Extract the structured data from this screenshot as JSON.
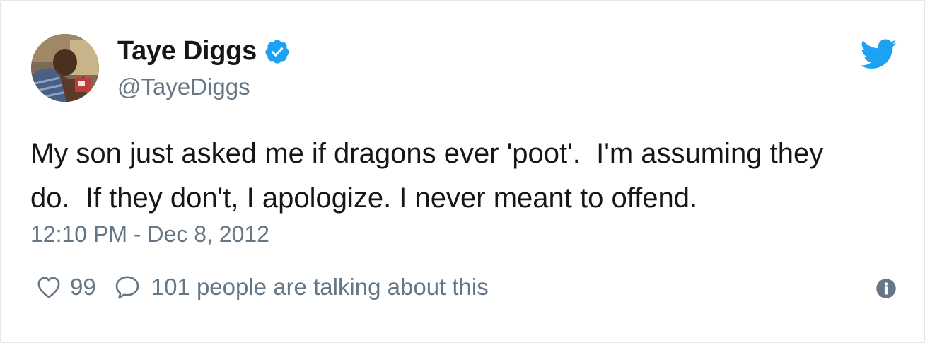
{
  "tweet": {
    "display_name": "Taye Diggs",
    "handle": "@TayeDiggs",
    "text": "My son just asked me if dragons ever 'poot'.  I'm assuming they\ndo.  If they don't, I apologize. I never meant to offend.",
    "timestamp": "12:10 PM - Dec 8, 2012",
    "likes": "99",
    "talking": "101 people are talking about this"
  },
  "icons": {
    "verified": "verified-badge-icon",
    "brand": "twitter-bird-icon",
    "like": "heart-icon",
    "reply": "speech-bubble-icon",
    "info": "info-icon"
  },
  "colors": {
    "brand_blue": "#1da1f2",
    "text_primary": "#14171a",
    "text_secondary": "#657786"
  }
}
